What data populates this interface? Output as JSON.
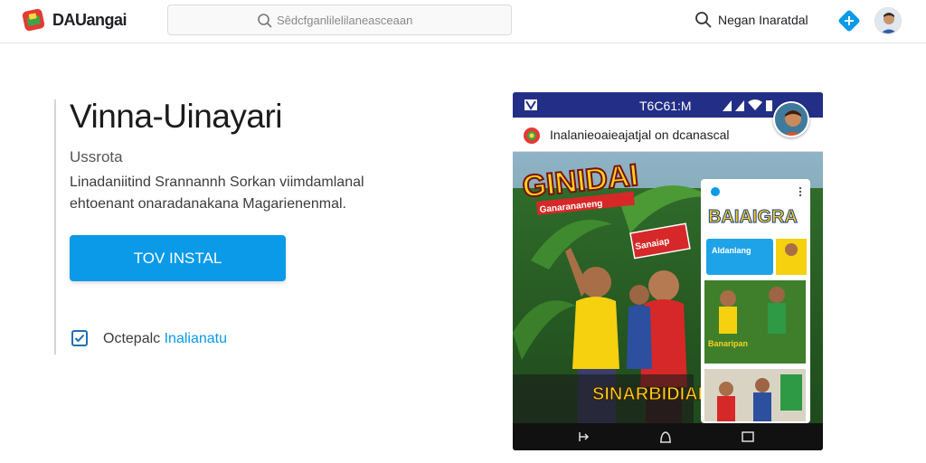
{
  "header": {
    "brand": "DAUangai",
    "search_placeholder": "Sêdcfganlilelilaneasceaan",
    "user_name": "Negan Inaratdal",
    "icons": [
      "brand-logo-icon",
      "search-icon",
      "plus-icon",
      "avatar"
    ]
  },
  "main": {
    "title": "Vinna-Uinayari",
    "subtitle": "Ussrota",
    "description": "Linadaniitind Srannannh Sorkan viimdamlanal ehtoenant onaradanakana Magarienenmal.",
    "install_label": "TOV INSTAL",
    "checkbox_label": "Octepalc",
    "checkbox_accent": "Inalianatu",
    "checkbox_checked": true
  },
  "phone": {
    "status_time": "T6C61:M",
    "app_bar_text": "Inalanieoaieajatjal on dcanascal",
    "poster_title": "GINIDAI",
    "poster_sub": "Ganarananeng",
    "poster_tag": "Sanaiap",
    "poster_bottom": "SINARBIDIAN",
    "card_title": "BAIAIGRA",
    "card_button": "Aldanlang",
    "card_caption": "Banaripan",
    "nav_icons": [
      "back-icon",
      "home-icon",
      "recents-icon"
    ]
  },
  "colors": {
    "accent": "#0a9ae8",
    "status_bar": "#232f86",
    "poster_yellow": "#f7d21e",
    "poster_red": "#d62828"
  }
}
